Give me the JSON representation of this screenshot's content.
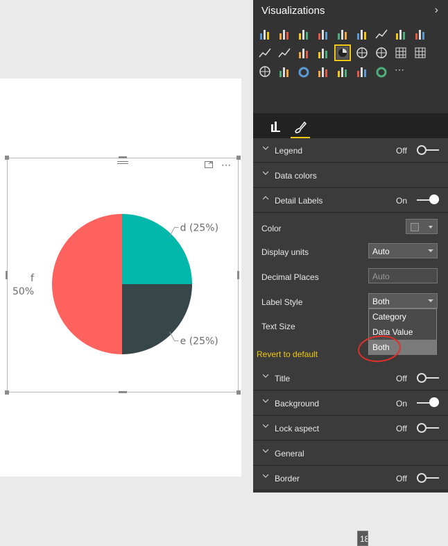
{
  "panel": {
    "title": "Visualizations",
    "tabs": [
      {
        "id": "fields",
        "icon": "fields-icon"
      },
      {
        "id": "format",
        "icon": "paint-roller-icon",
        "active": true
      }
    ],
    "cards": [
      {
        "title": "Legend",
        "state": "Off",
        "expanded": false
      },
      {
        "title": "Data colors",
        "state": "",
        "expanded": false
      },
      {
        "title": "Detail Labels",
        "state": "On",
        "expanded": true
      },
      {
        "title": "Title",
        "state": "Off",
        "expanded": false
      },
      {
        "title": "Background",
        "state": "On",
        "expanded": false
      },
      {
        "title": "Lock aspect",
        "state": "Off",
        "expanded": false
      },
      {
        "title": "General",
        "state": "",
        "expanded": false
      },
      {
        "title": "Border",
        "state": "Off",
        "expanded": false
      }
    ],
    "detail_labels": {
      "color_label": "Color",
      "display_units_label": "Display units",
      "display_units_value": "Auto",
      "decimal_places_label": "Decimal Places",
      "decimal_places_placeholder": "Auto",
      "label_style_label": "Label Style",
      "label_style_value": "Both",
      "label_style_options": [
        "Category",
        "Data Value",
        "Both"
      ],
      "text_size_label": "Text Size",
      "text_size_value": "18",
      "revert": "Revert to default"
    }
  },
  "colors": {
    "accent": "#f2c811",
    "annotation": "#e0302a",
    "panel_bg": "#333333"
  },
  "chart_data": {
    "type": "pie",
    "slices": [
      {
        "label": "d (25%)",
        "category": "d",
        "value": 25,
        "color": "#01b8aa"
      },
      {
        "label": "e (25%)",
        "category": "e",
        "value": 25,
        "color": "#374649"
      },
      {
        "label": "f",
        "category": "f",
        "value": 50,
        "percent_label": "50%",
        "color": "#fd625e"
      }
    ],
    "legend": "off"
  }
}
